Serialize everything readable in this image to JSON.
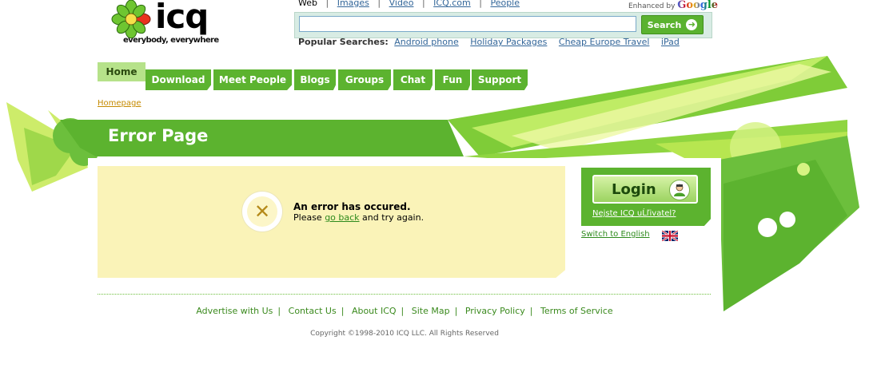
{
  "logo": {
    "brand": "icq",
    "tagline": "everybody, everywhere"
  },
  "search_nav": {
    "active": "Web",
    "links": [
      "Images",
      "Video",
      "ICQ.com",
      "People"
    ],
    "enhanced_prefix": "Enhanced by",
    "enhanced_brand": "Google"
  },
  "search": {
    "input_value": "",
    "button_label": "Search"
  },
  "popular": {
    "label": "Popular Searches:",
    "items": [
      "Android phone",
      "Holiday Packages",
      "Cheap Europe Travel",
      "iPad"
    ]
  },
  "tabs": [
    "Home",
    "Download",
    "Meet People",
    "Blogs",
    "Groups",
    "Chat",
    "Fun",
    "Support"
  ],
  "breadcrumb": "Homepage",
  "banner_title": "Error Page",
  "error": {
    "title": "An error has occured.",
    "msg_before": "Please ",
    "msg_link": "go back",
    "msg_after": " and try again."
  },
  "login": {
    "button_label": "Login",
    "not_user": "Nejste ICQ uĹľivatel?",
    "switch_lang": "Switch to English"
  },
  "footer": {
    "links": [
      "Advertise with Us",
      "Contact Us",
      "About ICQ",
      "Site Map",
      "Privacy Policy",
      "Terms of Service"
    ],
    "copyright": "Copyright ©1998-2010 ICQ LLC. All Rights Reserved"
  },
  "colors": {
    "brand_green": "#5cb32f",
    "light_green": "#b6e28a",
    "panel_yellow": "#faf3b8",
    "link_blue": "#336699"
  }
}
